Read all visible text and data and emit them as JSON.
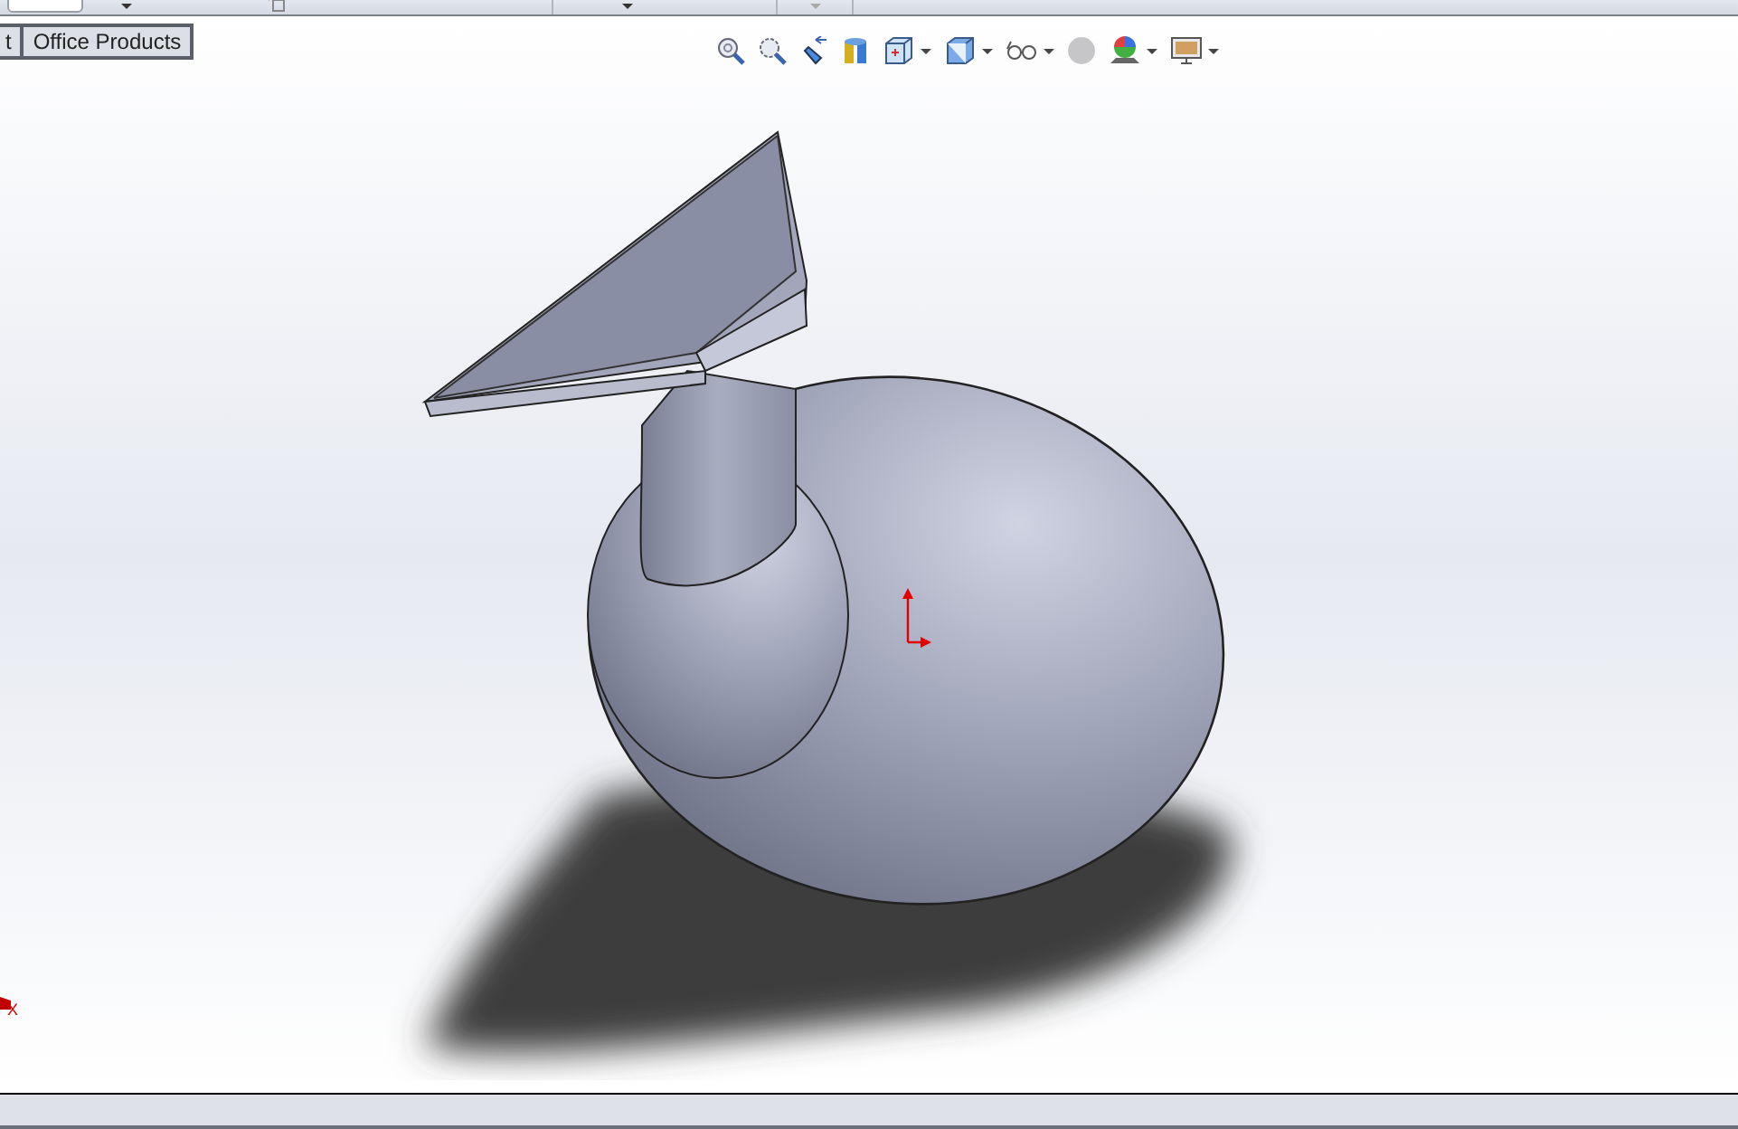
{
  "tabs": [
    {
      "label": "t"
    },
    {
      "label": "Office Products"
    }
  ],
  "triad": {
    "axis_label": "X"
  }
}
